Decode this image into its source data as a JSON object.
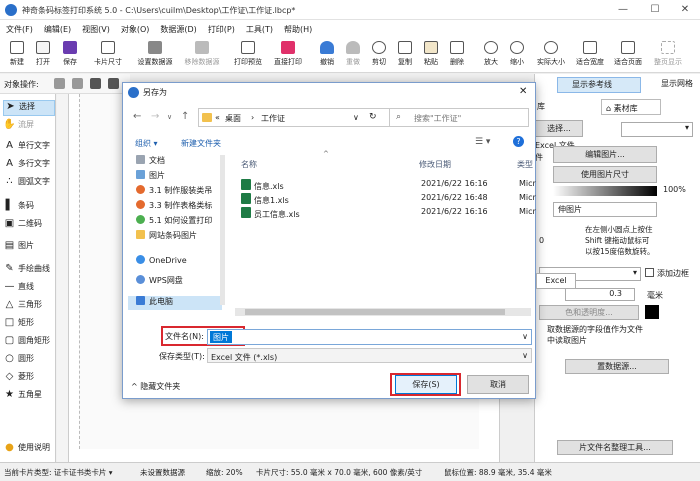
{
  "app": {
    "title": "神奇条码标签打印系统 5.0 - C:\\Users\\cuilm\\Desktop\\工作证\\工作证.lbcp*",
    "window_controls": {
      "minimize": "—",
      "restore": "☐",
      "close": "✕"
    }
  },
  "menu": [
    "文件(F)",
    "编辑(E)",
    "视图(V)",
    "对象(O)",
    "数据源(D)",
    "打印(P)",
    "工具(T)",
    "帮助(H)"
  ],
  "toolbar": [
    "新建",
    "打开",
    "保存",
    "卡片尺寸",
    "设置数据源",
    "移除数据源",
    "打印预览",
    "直接打印",
    "撤销",
    "重做",
    "剪切",
    "复制",
    "粘贴",
    "删除",
    "放大",
    "缩小",
    "实际大小",
    "适合宽度",
    "适合页面",
    "整页显示"
  ],
  "object_ops_label": "对象操作:",
  "left_tools": [
    "选择",
    "流屏",
    "单行文字",
    "多行文字",
    "圆弧文字",
    "条码",
    "二维码",
    "图片",
    "手绘曲线",
    "直线",
    "三角形",
    "矩形",
    "圆角矩形",
    "圆形",
    "菱形",
    "五角星"
  ],
  "left_help": "使用说明",
  "right_panel": {
    "toggles": [
      "显示参考线",
      "显示网格"
    ],
    "tabs": [
      "库",
      "素材库"
    ],
    "buttons": [
      "选择...",
      "编辑图片...",
      "使用图片尺寸",
      "伸图片",
      "片文件名整理工具..."
    ],
    "labels": [
      "Excel 文件",
      "件",
      "在左侧小圆点上按住",
      "Shift 键拖动鼠标可",
      "以按15度倍数旋转。",
      "添加边框",
      "毫米",
      "色和透明度...",
      "取数据源的字段值作为文件",
      "中读取图片",
      "置数据源..."
    ],
    "percent": "100%",
    "rotate_value": "0",
    "border_width": "0.3"
  },
  "status": {
    "card_type": "当前卡片类型: 证卡证书类卡片 ▾",
    "datasource": "未设置数据源",
    "zoom": "缩放: 20%",
    "card_size": "卡片尺寸: 55.0 毫米 x 70.0 毫米, 600 像素/英寸",
    "mouse_pos": "鼠标位置: 88.9 毫米, 35.4 毫米"
  },
  "dialog": {
    "title": "另存为",
    "breadcrumb": [
      "桌面",
      "工作证"
    ],
    "breadcrumb_prefix": "«",
    "search_placeholder": "搜索\"工作证\"",
    "toolbar": {
      "organize": "组织 ▾",
      "new_folder": "新建文件夹"
    },
    "nav_items": [
      "文档",
      "图片",
      "3.1 制作服装类吊",
      "3.3 制作表格类标",
      "5.1 如何设置打印",
      "网站条码图片",
      "OneDrive",
      "WPS网盘",
      "此电脑"
    ],
    "columns": {
      "name": "名称",
      "modified": "修改日期",
      "type": "类型"
    },
    "files": [
      {
        "name": "信息.xls",
        "modified": "2021/6/22 16:16",
        "type": "Micr"
      },
      {
        "name": "信息1.xls",
        "modified": "2021/6/22 16:48",
        "type": "Micr"
      },
      {
        "name": "员工信息.xls",
        "modified": "2021/6/22 16:16",
        "type": "Micr"
      }
    ],
    "filename_label": "文件名(N):",
    "filename_value": "图片",
    "filetype_label": "保存类型(T):",
    "filetype_value": "Excel 文件 (*.xls)",
    "hide_folders": "隐藏文件夹",
    "save_button": "保存(S)",
    "cancel_button": "取消",
    "behind_dialog_button": "Excel"
  },
  "colors": {
    "accent": "#0078d7",
    "highlight_border": "#d9282f",
    "selection": "#0078d7"
  }
}
